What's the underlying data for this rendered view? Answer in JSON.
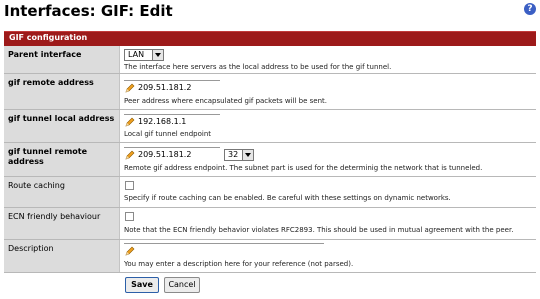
{
  "page": {
    "title": "Interfaces: GIF: Edit",
    "help_icon": "help-icon"
  },
  "section": {
    "title": "GIF configuration",
    "color": "#9d1a1a"
  },
  "fields": {
    "parent_interface": {
      "label": "Parent interface",
      "value": "LAN",
      "hint": "The interface here servers as the local address to be used for the gif tunnel."
    },
    "remote_address": {
      "label": "gif remote address",
      "value": "209.51.181.2",
      "hint": "Peer address where encapsulated gif packets will be sent."
    },
    "tunnel_local": {
      "label": "gif tunnel local address",
      "value": "192.168.1.1",
      "hint": "Local gif tunnel endpoint"
    },
    "tunnel_remote": {
      "label": "gif tunnel remote address",
      "value": "209.51.181.2",
      "subnet": "32",
      "hint": "Remote gif address endpoint. The subnet part is used for the determinig the network that is tunneled."
    },
    "route_caching": {
      "label": "Route caching",
      "checked": false,
      "hint": "Specify if route caching can be enabled. Be careful with these settings on dynamic networks."
    },
    "ecn": {
      "label": "ECN friendly behaviour",
      "checked": false,
      "hint": "Note that the ECN friendly behavior violates RFC2893. This should be used in mutual agreement with the peer."
    },
    "description": {
      "label": "Description",
      "value": "",
      "hint": "You may enter a description here for your reference (not parsed)."
    }
  },
  "buttons": {
    "save": "Save",
    "cancel": "Cancel"
  }
}
